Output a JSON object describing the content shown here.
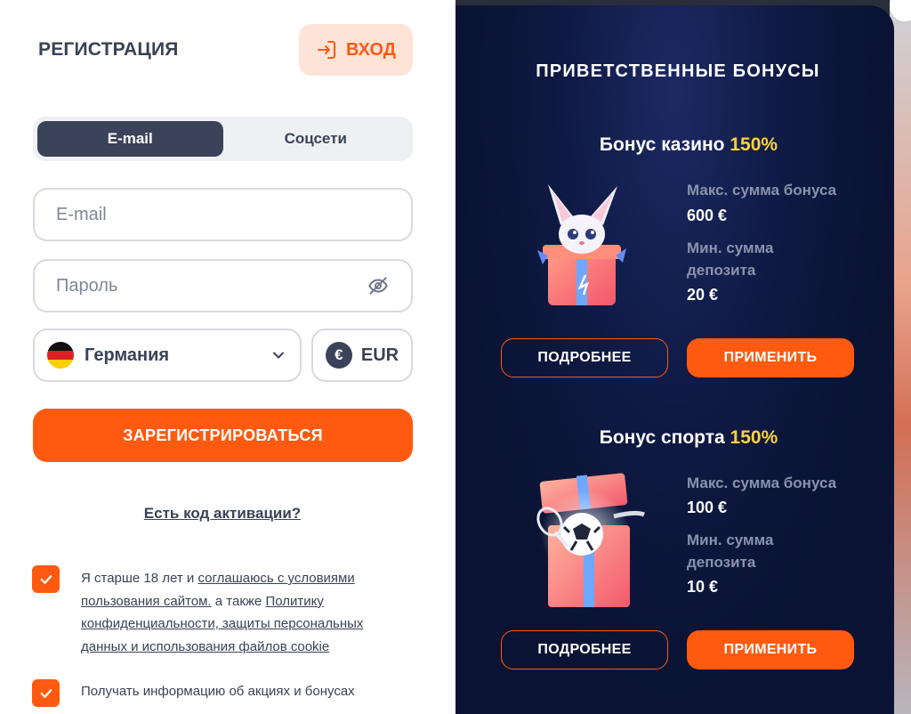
{
  "registration": {
    "title": "РЕГИСТРАЦИЯ",
    "login_label": "ВХОД",
    "tabs": [
      {
        "label": "E-mail",
        "active": true
      },
      {
        "label": "Соцсети",
        "active": false
      }
    ],
    "email_placeholder": "E-mail",
    "password_placeholder": "Пароль",
    "country": "Германия",
    "currency": "EUR",
    "currency_symbol": "€",
    "register_label": "ЗАРЕГИСТРИРОВАТЬСЯ",
    "activation_link": "Есть код активации?",
    "consent": {
      "prefix": "Я старше 18 лет и ",
      "link1": "соглашаюсь с условиями пользования сайтом.",
      "middle": " а также ",
      "link2": "Политику конфиденциальности, защиты персональных данных и использования файлов cookie",
      "checked": true
    },
    "promo_consent": {
      "label": "Получать информацию об акциях и бонусах",
      "checked": true
    }
  },
  "bonuses": {
    "heading": "ПРИВЕТСТВЕННЫЕ БОНУСЫ",
    "items": [
      {
        "title": "Бонус казино",
        "percent": "150%",
        "max_label": "Макс. сумма бонуса",
        "max_value": "600 €",
        "min_label_line1": "Мин. сумма",
        "min_label_line2": "депозита",
        "min_value": "20 €",
        "more_label": "ПОДРОБНЕЕ",
        "apply_label": "ПРИМЕНИТЬ"
      },
      {
        "title": "Бонус спорта",
        "percent": "150%",
        "max_label": "Макс. сумма бонуса",
        "max_value": "100 €",
        "min_label_line1": "Мин. сумма",
        "min_label_line2": "депозита",
        "min_value": "10 €",
        "more_label": "ПОДРОБНЕЕ",
        "apply_label": "ПРИМЕНИТЬ"
      }
    ]
  },
  "colors": {
    "accent": "#ff5a0f",
    "highlight": "#ffd23a",
    "panel_dark": "#0f1a45",
    "text_dark": "#3a4256"
  }
}
